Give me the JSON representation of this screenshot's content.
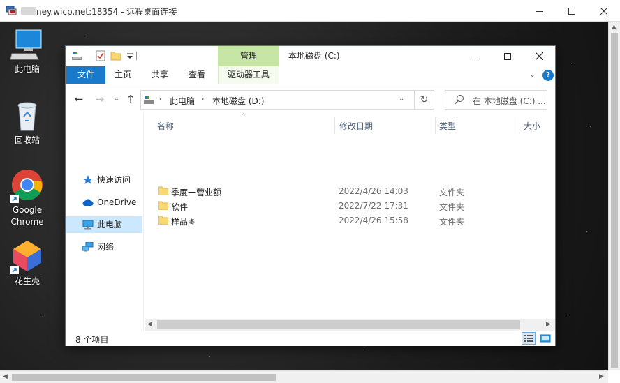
{
  "rdp": {
    "title": "ney.wicp.net:18354 - 远程桌面连接",
    "minimize_icon": "minimize-icon",
    "maximize_icon": "maximize-icon",
    "close_icon": "close-icon"
  },
  "desktop": {
    "icons": [
      {
        "label": "此电脑",
        "icon": "computer-icon"
      },
      {
        "label": "回收站",
        "icon": "recycle-bin-icon"
      },
      {
        "label": "Google Chrome",
        "icon": "chrome-icon"
      },
      {
        "label": "花生壳",
        "icon": "peanut-shell-icon"
      }
    ]
  },
  "explorer": {
    "title": "本地磁盘 (C:)",
    "contextual_tab_group": "管理",
    "ribbon_tabs": [
      "文件",
      "主页",
      "共享",
      "查看",
      "驱动器工具"
    ],
    "breadcrumb": [
      "此电脑",
      "本地磁盘 (D:)"
    ],
    "search_placeholder": "在 本地磁盘 (C:) ...",
    "nav_items": [
      "快速访问",
      "OneDrive",
      "此电脑",
      "网络"
    ],
    "columns": [
      "名称",
      "修改日期",
      "类型",
      "大小"
    ],
    "files": [
      {
        "name": "季度一营业额",
        "date": "2022/4/26 14:03",
        "type": "文件夹"
      },
      {
        "name": "软件",
        "date": "2022/7/22 17:31",
        "type": "文件夹"
      },
      {
        "name": "样品图",
        "date": "2022/4/26 15:58",
        "type": "文件夹"
      }
    ],
    "status_count": "8 个项目",
    "colors": {
      "accent": "#1979ca",
      "manage_tab": "#c7e5a4",
      "selection": "#cce8ff",
      "folder": "#f8d775"
    }
  }
}
